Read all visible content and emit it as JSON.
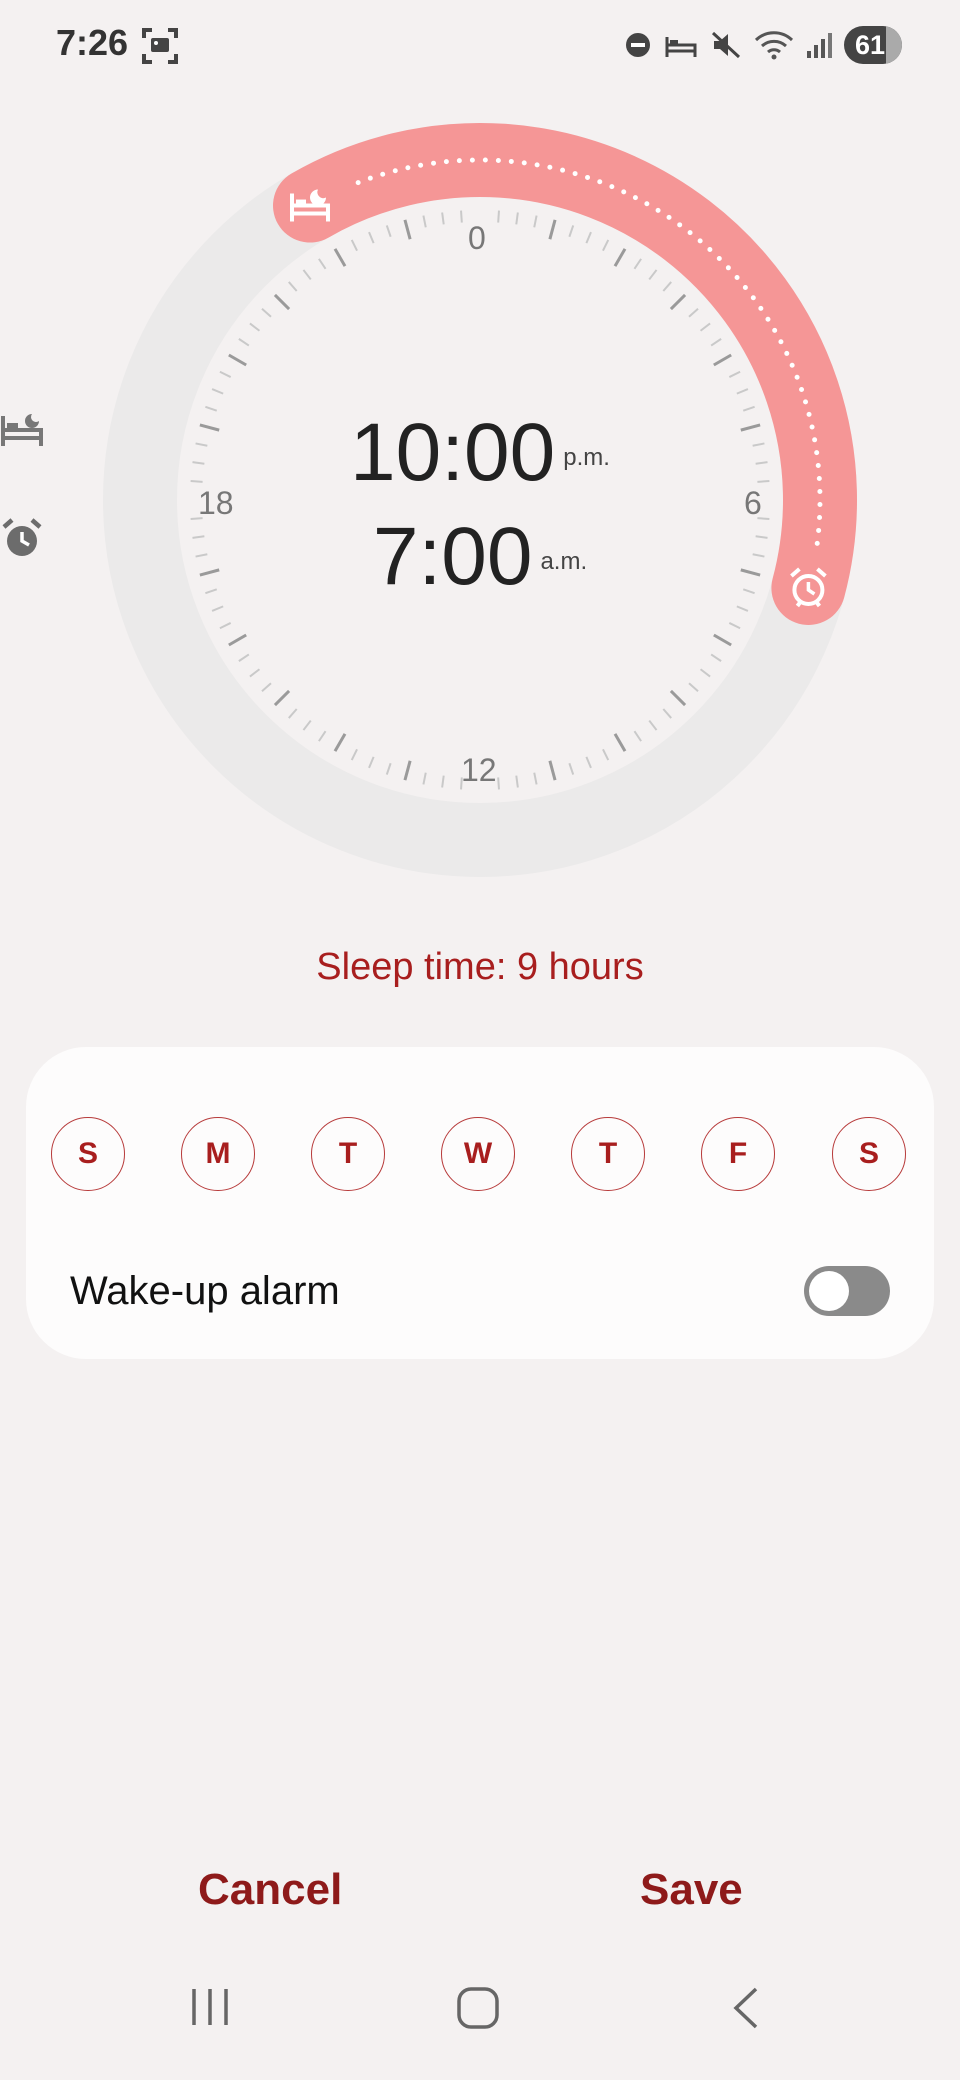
{
  "status_bar": {
    "time": "7:26",
    "battery": "61",
    "icons": [
      "screenshot-icon",
      "dnd-icon",
      "bed-icon",
      "mute-icon",
      "wifi-icon",
      "signal-icon",
      "battery-icon"
    ]
  },
  "dial": {
    "labels": {
      "top": "0",
      "right": "6",
      "bottom": "12",
      "left": "18"
    },
    "bedtime": {
      "time": "10:00",
      "ampm": "p.m."
    },
    "wakeup": {
      "time": "7:00",
      "ampm": "a.m."
    },
    "arc_color": "#f59696"
  },
  "sleep_time": "Sleep time: 9 hours",
  "days": [
    "S",
    "M",
    "T",
    "W",
    "T",
    "F",
    "S"
  ],
  "wake_up_alarm": {
    "label": "Wake-up alarm",
    "enabled": false
  },
  "actions": {
    "cancel": "Cancel",
    "save": "Save"
  },
  "colors": {
    "accent": "#a81e1e",
    "background": "#f4f1f1"
  }
}
